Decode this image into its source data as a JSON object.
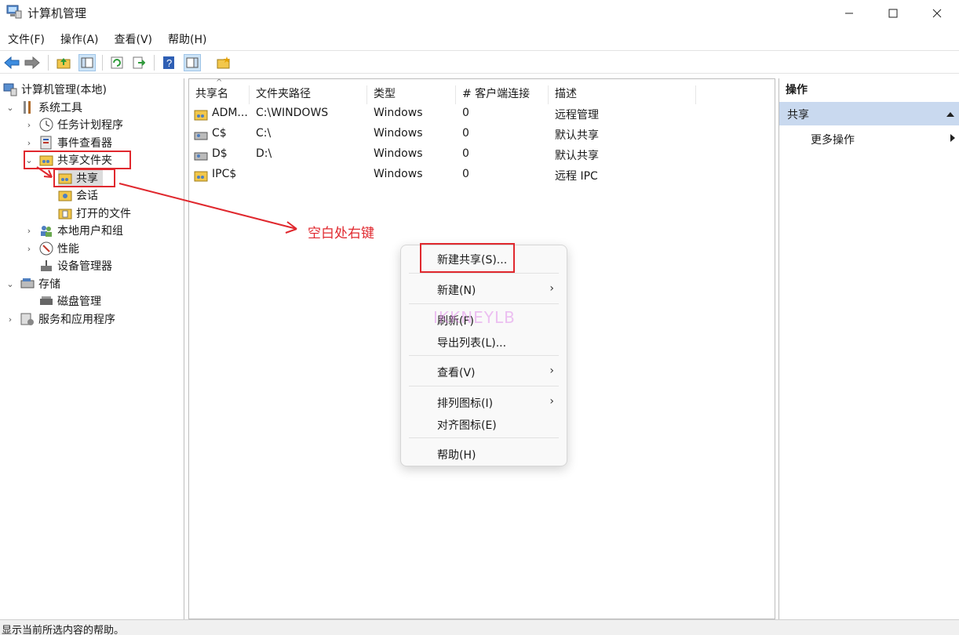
{
  "window": {
    "title": "计算机管理"
  },
  "menubar": {
    "items": [
      "文件(F)",
      "操作(A)",
      "查看(V)",
      "帮助(H)"
    ]
  },
  "tree": {
    "root": "计算机管理(本地)",
    "system_tools": "系统工具",
    "task_scheduler": "任务计划程序",
    "event_viewer": "事件查看器",
    "shared_folders": "共享文件夹",
    "shares": "共享",
    "sessions": "会话",
    "open_files": "打开的文件",
    "local_users": "本地用户和组",
    "performance": "性能",
    "device_manager": "设备管理器",
    "storage": "存储",
    "disk_management": "磁盘管理",
    "services_apps": "服务和应用程序"
  },
  "list": {
    "columns": [
      "共享名",
      "文件夹路径",
      "类型",
      "# 客户端连接",
      "描述"
    ],
    "rows": [
      {
        "name": "ADM...",
        "path": "C:\\WINDOWS",
        "type": "Windows",
        "clients": "0",
        "desc": "远程管理"
      },
      {
        "name": "C$",
        "path": "C:\\",
        "type": "Windows",
        "clients": "0",
        "desc": "默认共享"
      },
      {
        "name": "D$",
        "path": "D:\\",
        "type": "Windows",
        "clients": "0",
        "desc": "默认共享"
      },
      {
        "name": "IPC$",
        "path": "",
        "type": "Windows",
        "clients": "0",
        "desc": "远程 IPC"
      }
    ]
  },
  "actions": {
    "title": "操作",
    "section": "共享",
    "more": "更多操作"
  },
  "context_menu": {
    "new_share": "新建共享(S)...",
    "new": "新建(N)",
    "refresh": "刷新(F)",
    "export": "导出列表(L)...",
    "view": "查看(V)",
    "arrange": "排列图标(I)",
    "align": "对齐图标(E)",
    "help": "帮助(H)"
  },
  "annotation": {
    "text": "空白处右键"
  },
  "watermark": {
    "text": "IKKNEYLB"
  },
  "status": {
    "text": "显示当前所选内容的帮助。"
  },
  "colors": {
    "annotation": "#e0282e",
    "action_section": "#c9d9ef"
  }
}
